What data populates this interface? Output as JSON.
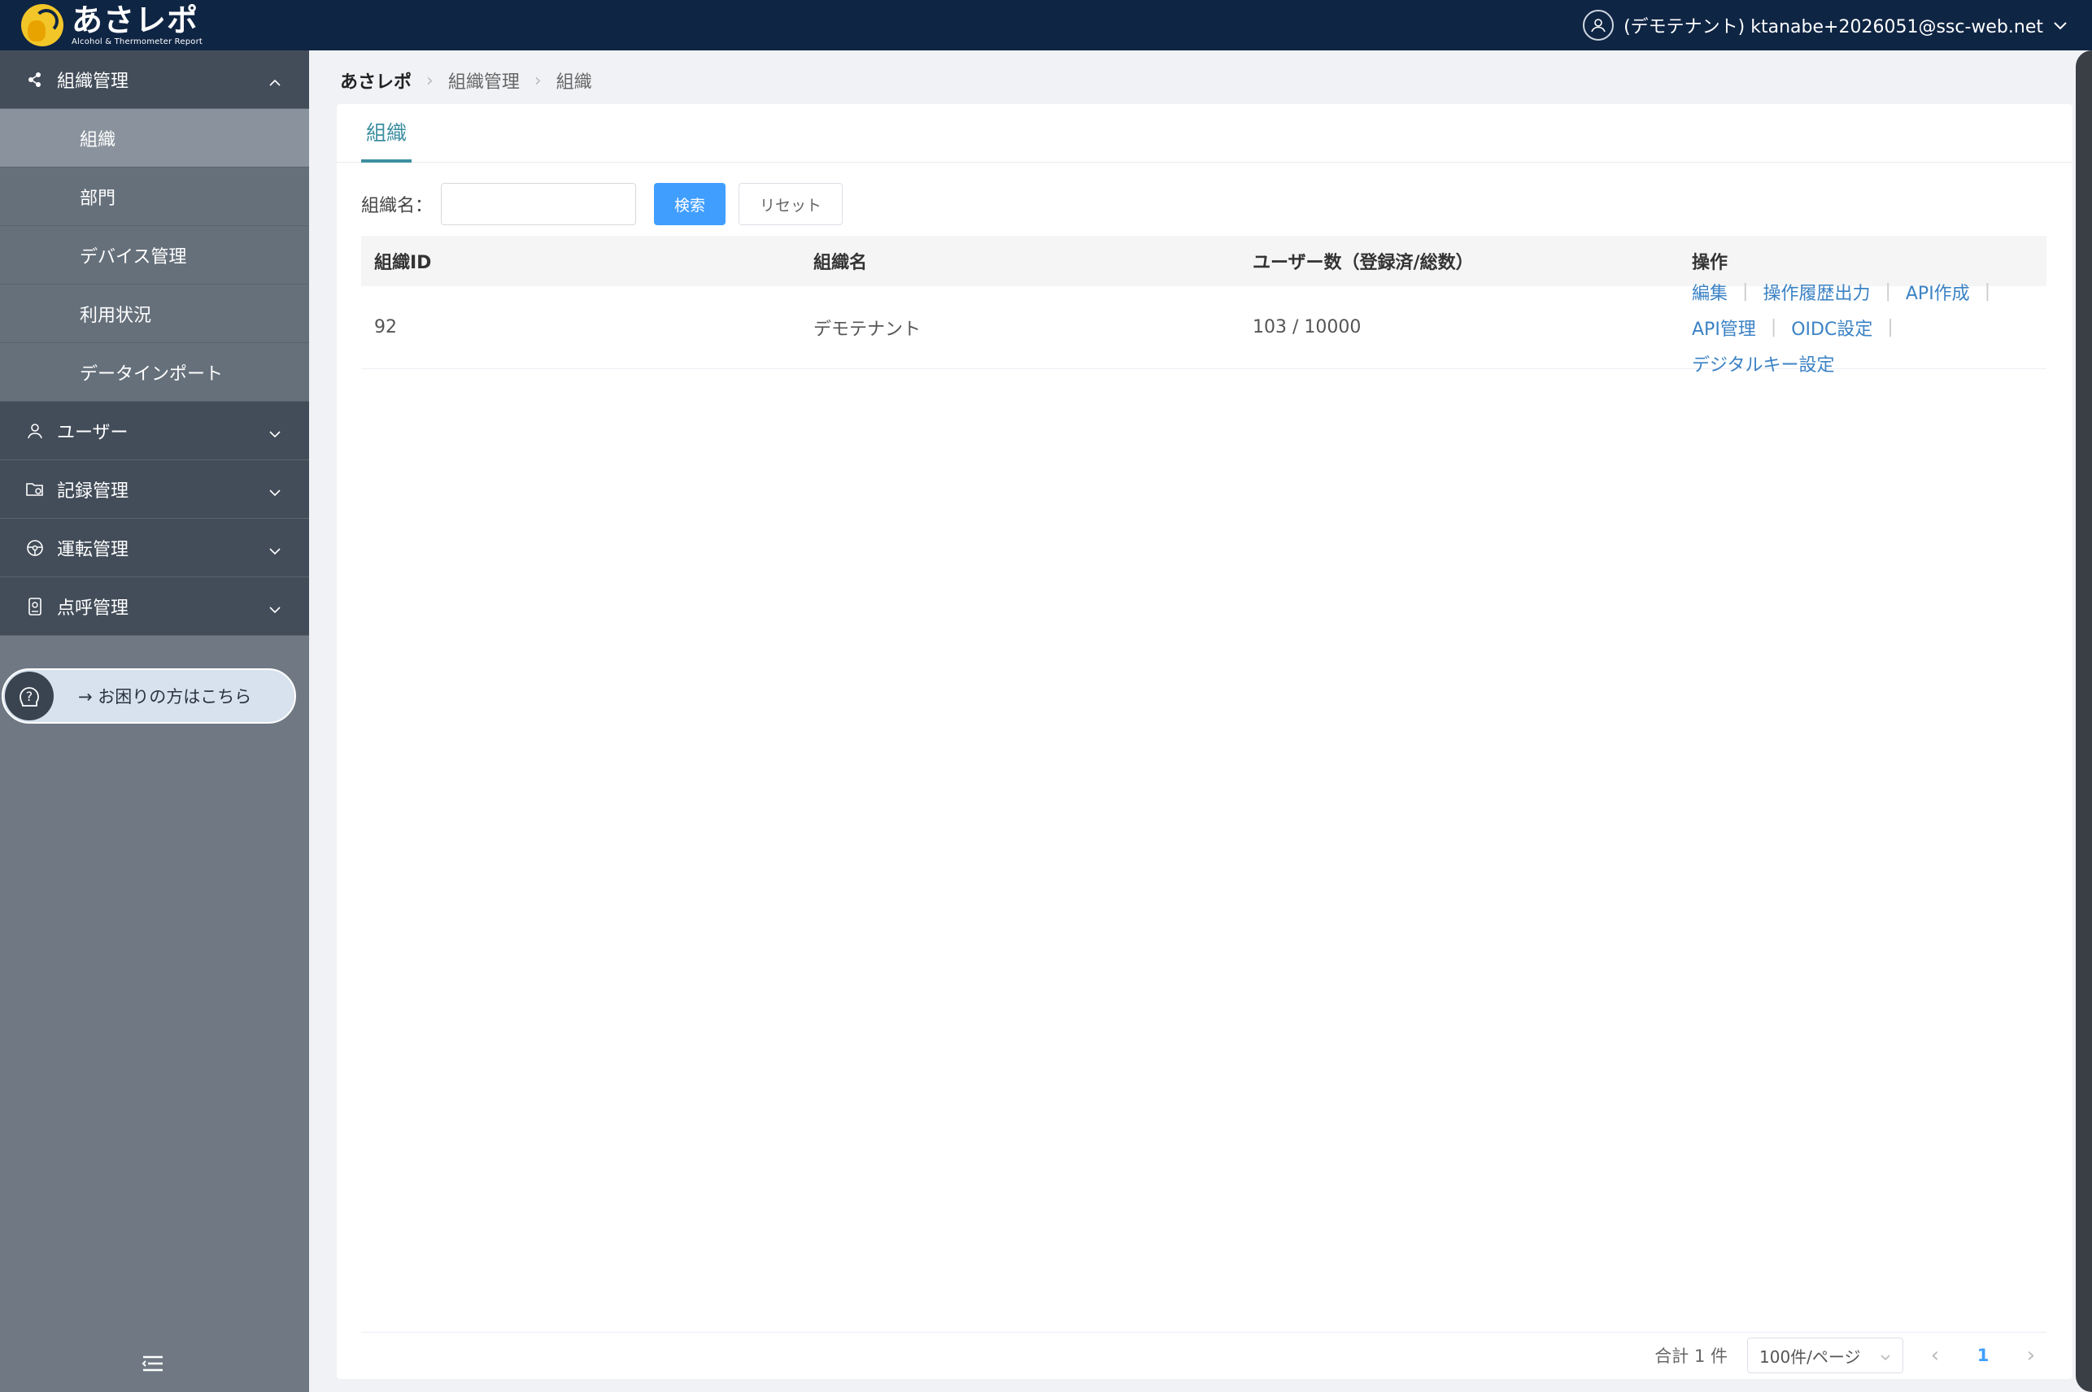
{
  "brand": {
    "name": "あさレポ",
    "subtitle": "Alcohol & Thermometer Report"
  },
  "header": {
    "user_label": "(デモテナント) ktanabe+2026051@ssc-web.net"
  },
  "sidebar": {
    "groups": [
      {
        "label": "組織管理",
        "icon": "share-icon",
        "expanded": true
      },
      {
        "label": "ユーザー",
        "icon": "user-icon",
        "expanded": false
      },
      {
        "label": "記録管理",
        "icon": "folder-settings-icon",
        "expanded": false
      },
      {
        "label": "運転管理",
        "icon": "steering-wheel-icon",
        "expanded": false
      },
      {
        "label": "点呼管理",
        "icon": "badge-icon",
        "expanded": false
      }
    ],
    "sub_items": [
      {
        "label": "組織",
        "active": true
      },
      {
        "label": "部門",
        "active": false
      },
      {
        "label": "デバイス管理",
        "active": false
      },
      {
        "label": "利用状況",
        "active": false
      },
      {
        "label": "データインポート",
        "active": false
      }
    ],
    "help_label": "→ お困りの方はこちら"
  },
  "breadcrumb": {
    "items": [
      "あさレポ",
      "組織管理",
      "組織"
    ]
  },
  "tab": {
    "label": "組織"
  },
  "search": {
    "label": "組織名：",
    "value": "",
    "placeholder": "",
    "search_button": "検索",
    "reset_button": "リセット"
  },
  "table": {
    "columns": [
      "組織ID",
      "組織名",
      "ユーザー数（登録済/総数）",
      "操作"
    ],
    "rows": [
      {
        "id": "92",
        "name": "デモテナント",
        "users": "103 / 10000",
        "actions": [
          "編集",
          "操作履歴出力",
          "API作成",
          "API管理",
          "OIDC設定",
          "デジタルキー設定"
        ]
      }
    ]
  },
  "pagination": {
    "total_label": "合計 1 件",
    "page_size": "100件/ページ",
    "current_page": "1"
  },
  "colors": {
    "topbar": "#0f2544",
    "sidebar": "#6f7883",
    "sidebar_group": "#434d59",
    "accent": "#3d8fa0",
    "primary_button": "#409eff",
    "link": "#3b82c4"
  }
}
